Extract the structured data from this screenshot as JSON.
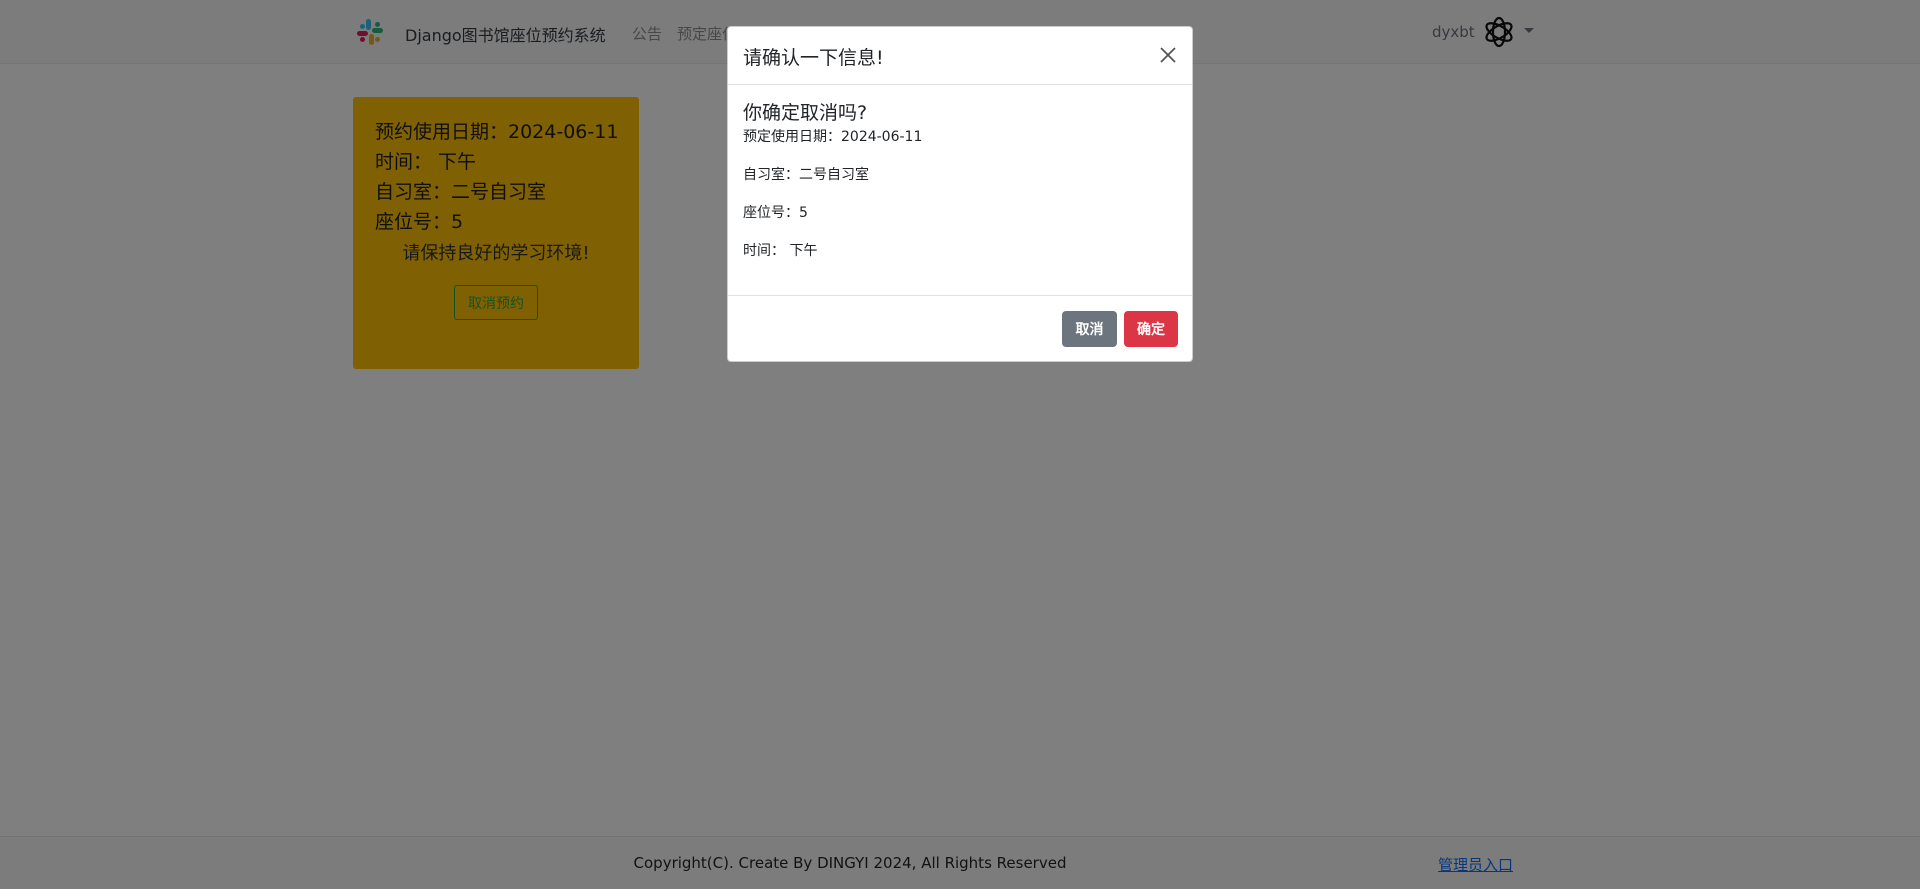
{
  "navbar": {
    "brand": "Django图书馆座位预约系统",
    "links": [
      "公告",
      "预定座位"
    ],
    "username": "dyxbt"
  },
  "reservation": {
    "date_label": "预约使用日期：2024-06-11",
    "time_label": "时间：  下午",
    "room_label": "自习室：二号自习室",
    "seat_label": "座位号：5",
    "hint": "请保持良好的学习环境!",
    "cancel_button": "取消预约"
  },
  "modal": {
    "title": "请确认一下信息!",
    "question": "你确定取消吗?",
    "details": [
      "预定使用日期：2024-06-11",
      "自习室：二号自习室",
      "座位号：5",
      "时间：  下午"
    ],
    "cancel_button": "取消",
    "confirm_button": "确定"
  },
  "footer": {
    "copyright": "Copyright(C). Create By DINGYI 2024, All Rights Reserved",
    "admin_link": "管理员入口"
  },
  "colors": {
    "card_bg": "#ffc107",
    "confirm_bg": "#dc3545",
    "cancel_bg": "#6c757d",
    "outline_green": "#28a745",
    "link_blue": "#0d6efd"
  },
  "icons": {
    "brand": "slack-logo-icon",
    "avatar": "openai-logo-icon",
    "close": "close-icon",
    "caret": "chevron-down-icon"
  }
}
